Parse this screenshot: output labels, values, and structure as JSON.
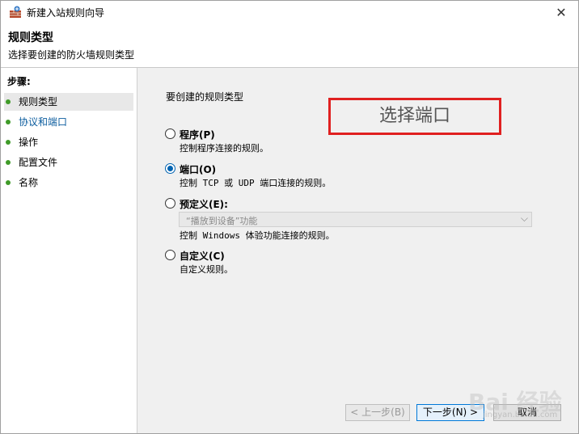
{
  "window": {
    "title": "新建入站规则向导"
  },
  "header": {
    "title": "规则类型",
    "subtitle": "选择要创建的防火墙规则类型"
  },
  "sidebar": {
    "steps_label": "步骤:",
    "items": [
      {
        "label": "规则类型",
        "state": "active"
      },
      {
        "label": "协议和端口",
        "state": "link"
      },
      {
        "label": "操作",
        "state": "normal"
      },
      {
        "label": "配置文件",
        "state": "normal"
      },
      {
        "label": "名称",
        "state": "normal"
      }
    ]
  },
  "main": {
    "question": "要创建的规则类型",
    "annotation": "选择端口",
    "options": [
      {
        "label": "程序(P)",
        "desc": "控制程序连接的规则。",
        "checked": false
      },
      {
        "label": "端口(O)",
        "desc": "控制 TCP 或 UDP 端口连接的规则。",
        "checked": true
      },
      {
        "label": "预定义(E):",
        "desc": "控制 Windows 体验功能连接的规则。",
        "checked": false
      },
      {
        "label": "自定义(C)",
        "desc": "自定义规则。",
        "checked": false
      }
    ],
    "predefined_select": {
      "value": "“播放到设备”功能"
    }
  },
  "buttons": {
    "back": "< 上一步(B)",
    "next": "下一步(N) >",
    "cancel": "取消"
  },
  "watermark": {
    "text": "Bai 经验",
    "sub": "jingyan.baidu.com"
  },
  "colors": {
    "annotation_border": "#e02020",
    "accent": "#0063b1",
    "step_dot": "#3f9b28",
    "link": "#0b5c9e"
  }
}
